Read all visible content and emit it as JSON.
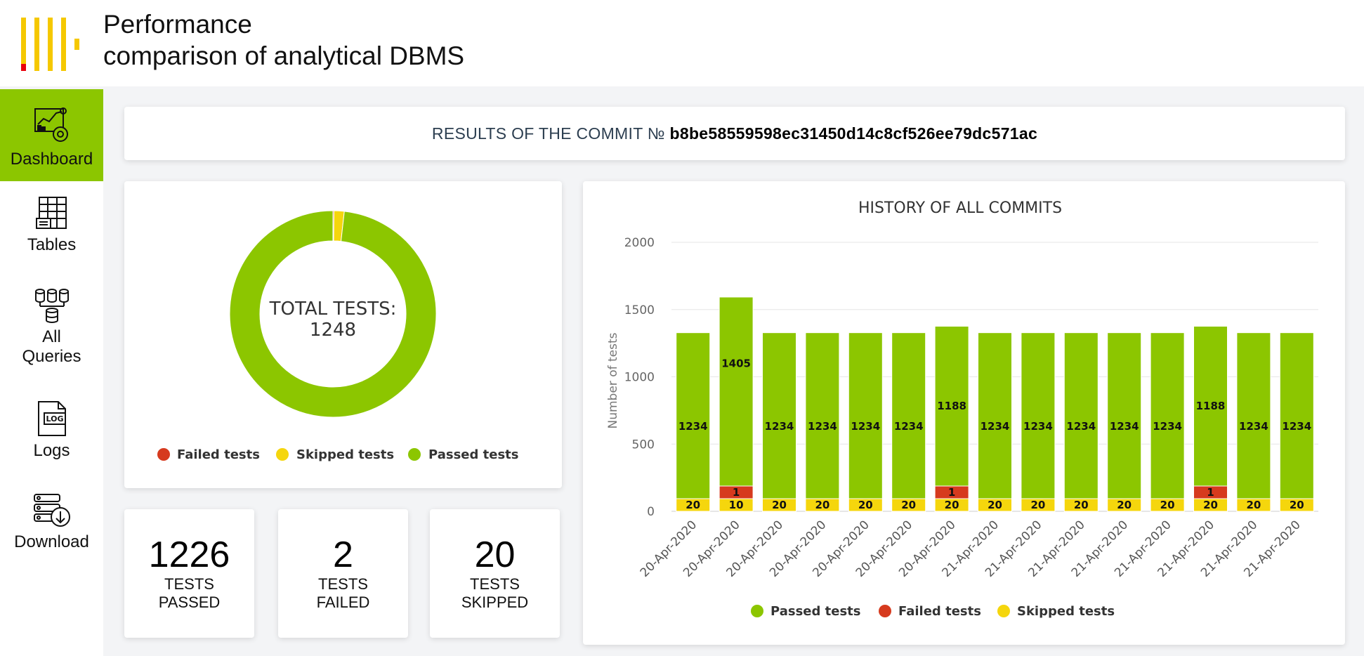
{
  "header": {
    "title_line1": "Performance",
    "title_line2": "comparison of analytical DBMS"
  },
  "sidebar": {
    "items": [
      {
        "label": "Dashboard",
        "icon": "dashboard-icon",
        "active": true
      },
      {
        "label": "Tables",
        "icon": "tables-icon"
      },
      {
        "label_line1": "All",
        "label_line2": "Queries",
        "icon": "database-icon"
      },
      {
        "label": "Logs",
        "icon": "log-file-icon",
        "icon_text": "LOG"
      },
      {
        "label": "Download",
        "icon": "download-icon"
      }
    ]
  },
  "commit": {
    "prefix": "RESULTS OF THE COMMIT №",
    "hash": "b8be58559598ec31450d14c8cf526ee79dc571ac"
  },
  "donut": {
    "center_line1": "TOTAL TESTS:",
    "center_line2": "1248",
    "legend": [
      {
        "label": "Failed tests",
        "color": "#d63a1e"
      },
      {
        "label": "Skipped tests",
        "color": "#f5d60d"
      },
      {
        "label": "Passed tests",
        "color": "#8cc600"
      }
    ]
  },
  "stats": [
    {
      "value": "1226",
      "line1": "TESTS",
      "line2": "PASSED"
    },
    {
      "value": "2",
      "line1": "TESTS",
      "line2": "FAILED"
    },
    {
      "value": "20",
      "line1": "TESTS",
      "line2": "SKIPPED"
    }
  ],
  "colors": {
    "passed": "#8cc600",
    "failed": "#d63a1e",
    "skipped": "#f5d60d",
    "logo_yellow": "#f5c800",
    "logo_red": "#e8000b"
  },
  "chart_data": [
    {
      "type": "pie",
      "title": "",
      "labels": [
        "Failed tests",
        "Skipped tests",
        "Passed tests"
      ],
      "values": [
        2,
        20,
        1226
      ],
      "colors": [
        "#d63a1e",
        "#f5d60d",
        "#8cc600"
      ]
    },
    {
      "type": "bar",
      "stacked": true,
      "title": "HISTORY OF ALL COMMITS",
      "xlabel": "",
      "ylabel": "Number of tests",
      "ylim": [
        0,
        2000
      ],
      "yticks": [
        0,
        500,
        1000,
        1500,
        2000
      ],
      "grid": true,
      "legend_position": "bottom",
      "categories": [
        "20-Apr-2020",
        "20-Apr-2020",
        "20-Apr-2020",
        "20-Apr-2020",
        "20-Apr-2020",
        "20-Apr-2020",
        "20-Apr-2020",
        "21-Apr-2020",
        "21-Apr-2020",
        "21-Apr-2020",
        "21-Apr-2020",
        "21-Apr-2020",
        "21-Apr-2020",
        "21-Apr-2020",
        "21-Apr-2020"
      ],
      "series": [
        {
          "name": "Skipped tests",
          "color": "#f5d60d",
          "values": [
            20,
            10,
            20,
            20,
            20,
            20,
            20,
            20,
            20,
            20,
            20,
            20,
            20,
            20,
            20
          ]
        },
        {
          "name": "Failed tests",
          "color": "#d63a1e",
          "values": [
            0,
            1,
            0,
            0,
            0,
            0,
            1,
            0,
            0,
            0,
            0,
            0,
            1,
            0,
            0
          ]
        },
        {
          "name": "Passed tests",
          "color": "#8cc600",
          "values": [
            1234,
            1405,
            1234,
            1234,
            1234,
            1234,
            1188,
            1234,
            1234,
            1234,
            1234,
            1234,
            1188,
            1234,
            1234
          ]
        }
      ],
      "legend_order": [
        "Passed tests",
        "Failed tests",
        "Skipped tests"
      ]
    }
  ]
}
